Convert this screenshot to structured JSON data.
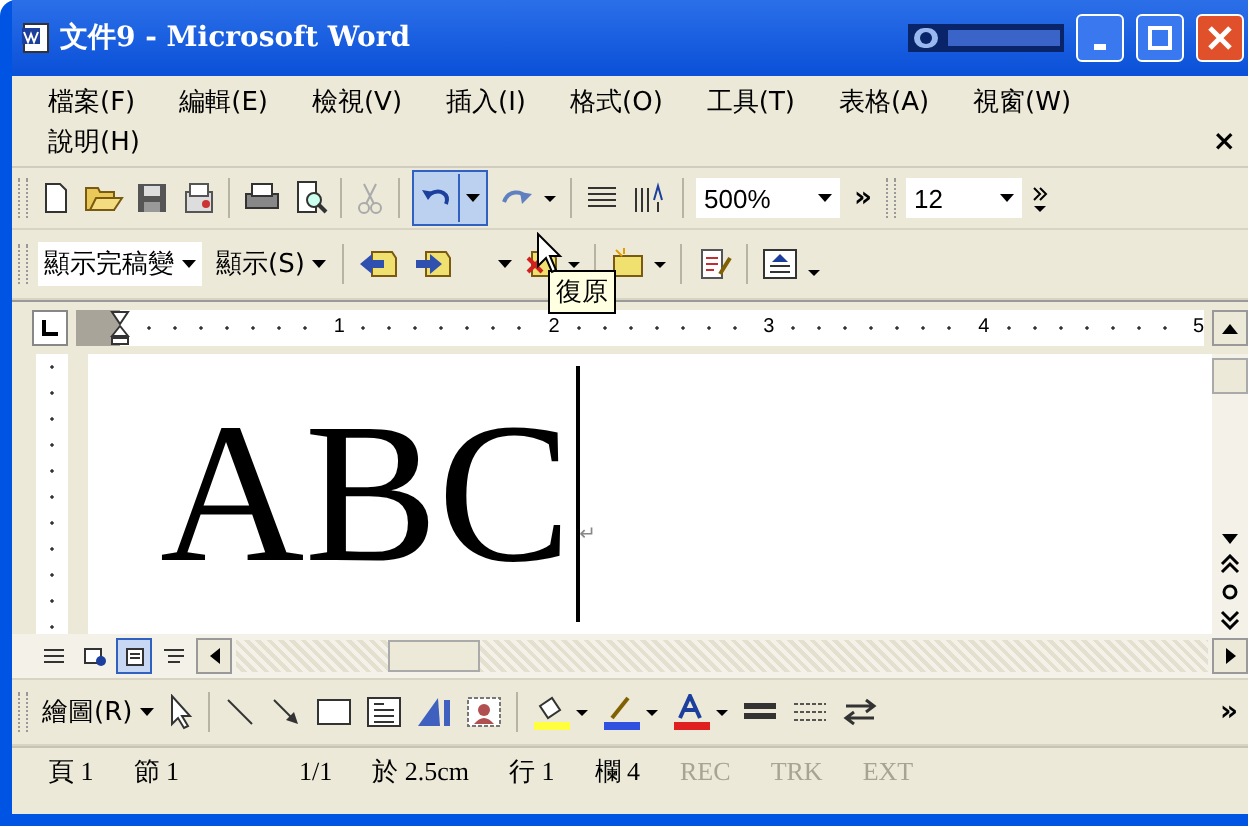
{
  "window": {
    "title": "文件9 - Microsoft Word"
  },
  "menu": [
    "檔案(F)",
    "編輯(E)",
    "檢視(V)",
    "插入(I)",
    "格式(O)",
    "工具(T)",
    "表格(A)",
    "視窗(W)",
    "說明(H)"
  ],
  "menu_close": "×",
  "standard_toolbar": {
    "zoom": "500%",
    "font_size": "12",
    "undo_pressed": true,
    "more": "»"
  },
  "reviewing_toolbar": {
    "markup_view": "顯示完稿變",
    "show_menu": "顯示(S)"
  },
  "tooltip": "復原",
  "ruler": [
    "1",
    "2",
    "3",
    "4",
    "5"
  ],
  "document": {
    "text": "ABC",
    "paragraph_mark": "↵"
  },
  "view_buttons": [
    {
      "kind": "normal",
      "selected": false
    },
    {
      "kind": "web",
      "selected": false
    },
    {
      "kind": "print",
      "selected": true
    },
    {
      "kind": "outline",
      "selected": false
    }
  ],
  "drawing_toolbar": {
    "menu": "繪圖(R)",
    "more": "»"
  },
  "status_bar": [
    {
      "text": "頁 1",
      "disabled": false
    },
    {
      "text": "節 1",
      "disabled": false
    },
    {
      "text": "1/1",
      "disabled": false
    },
    {
      "text": "於 2.5cm",
      "disabled": false
    },
    {
      "text": "行 1",
      "disabled": false
    },
    {
      "text": "欄 4",
      "disabled": false
    },
    {
      "text": "REC",
      "disabled": true
    },
    {
      "text": "TRK",
      "disabled": true
    },
    {
      "text": "EXT",
      "disabled": true
    }
  ]
}
